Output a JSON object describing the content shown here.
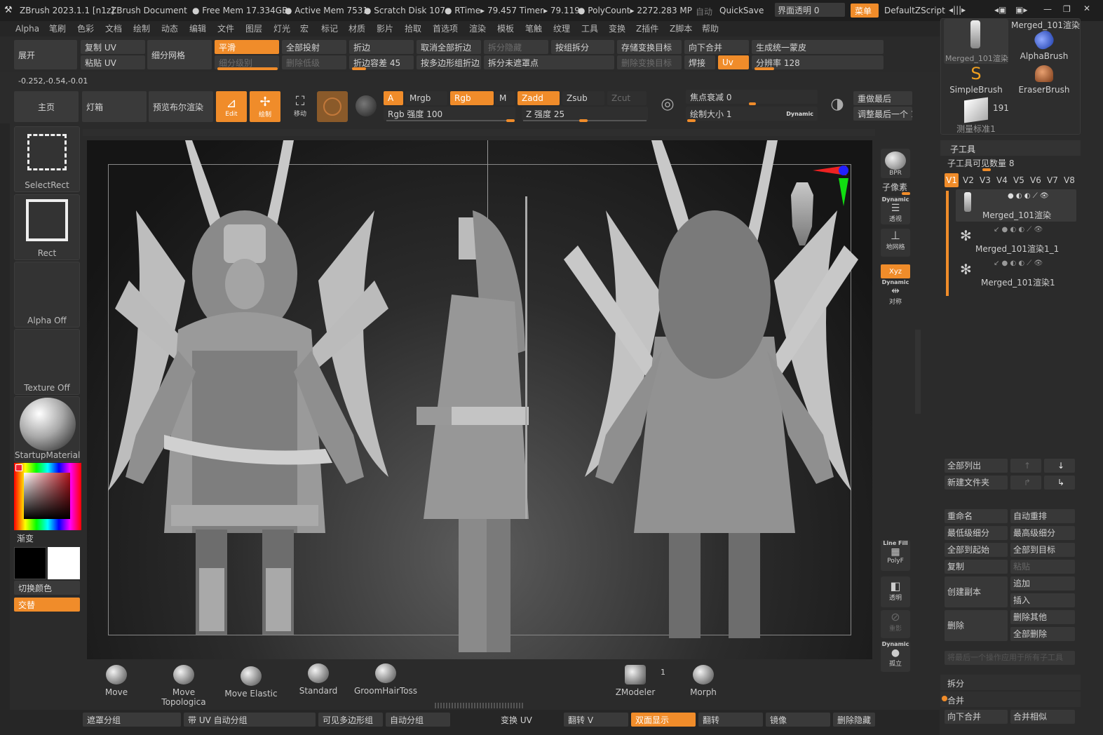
{
  "titlebar": {
    "app": "ZBrush 2023.1.1 [n1z]",
    "doc": "ZBrush Document",
    "free_mem": "Free Mem 17.334GB",
    "active_mem": "Active Mem 7531",
    "scratch": "Scratch Disk 107",
    "rtime": "RTime▸ 79.457 Timer▸ 79.119",
    "polycount": "PolyCount▸ 2272.283 MP",
    "auto": "自动",
    "quicksave": "QuickSave",
    "transparency": "界面透明 0",
    "menu": "菜单",
    "zscript": "DefaultZScript"
  },
  "menu": [
    "Alpha",
    "笔刷",
    "色彩",
    "文档",
    "绘制",
    "动态",
    "编辑",
    "文件",
    "图层",
    "灯光",
    "宏",
    "标记",
    "材质",
    "影片",
    "拾取",
    "首选项",
    "渲染",
    "模板",
    "笔触",
    "纹理",
    "工具",
    "变换",
    "Z插件",
    "Z脚本",
    "帮助"
  ],
  "toolbar1": {
    "unwrap": "展开",
    "copy_uv": "复制 UV",
    "paste_uv": "粘贴 UV",
    "subdivide": "细分网格",
    "smooth": "平滑",
    "subdiv_level": "细分级别",
    "project_all": "全部投射",
    "del_lower": "删除低级",
    "crease": "折边",
    "crease_tol": "折边容差 45",
    "uncrease_all": "取消全部折边",
    "crease_pg": "按多边形组折边",
    "split_hidden": "拆分隐藏",
    "split_unmasked": "拆分未遮罩点",
    "groups_split": "按组拆分",
    "store_morph": "存储变换目标",
    "del_morph": "删除变换目标",
    "merge_down": "向下合并",
    "weld": "焊接",
    "uv": "Uv",
    "unified_skin": "生成统一蒙皮",
    "resolution": "分辨率 128"
  },
  "coords": "-0.252,-0.54,-0.01",
  "toolbar2": {
    "home": "主页",
    "lightbox": "灯箱",
    "preview_bool": "预览布尔渲染",
    "edit": "Edit",
    "draw": "绘制",
    "move": "移动",
    "a": "A",
    "mrgb": "Mrgb",
    "rgb": "Rgb",
    "m": "M",
    "rgb_intensity": "Rgb 强度 100",
    "zadd": "Zadd",
    "zsub": "Zsub",
    "zcut": "Zcut",
    "z_intensity": "Z 强度 25",
    "focal": "焦点衰减 0",
    "draw_size": "绘制大小 1",
    "dynamic": "Dynamic",
    "redo": "重做最后",
    "adjust_last": "调整最后一个 1"
  },
  "left_tiles": {
    "select_rect": "SelectRect",
    "rect": "Rect",
    "alpha_off": "Alpha Off",
    "texture_off": "Texture Off",
    "material": "StartupMaterial",
    "gradient": "渐变",
    "switch_color": "切换颜色",
    "alternate": "交替"
  },
  "canvas_side": {
    "bpr": "BPR",
    "subpixel": "子像素",
    "dynamic": "Dynamic",
    "persp": "透视",
    "floor": "地网格",
    "xyz": "Xyz",
    "dynamic2": "Dynamic",
    "sym": "对称",
    "linefill": "Line Fill",
    "polyf": "PolyF",
    "transp": "透明",
    "ghost": "重影",
    "dynamic3": "Dynamic",
    "solo": "孤立"
  },
  "brushes": [
    {
      "name": "Move"
    },
    {
      "name": "Move Topologica"
    },
    {
      "name": "Move Elastic"
    },
    {
      "name": "Standard"
    },
    {
      "name": "GroomHairToss"
    },
    {
      "name": "ZModeler",
      "badge": "1"
    },
    {
      "name": "Morph"
    }
  ],
  "bottombar": {
    "mask_group": "遮罩分组",
    "uv_autogroup": "带 UV 自动分组",
    "polygroup_visible": "可见多边形组",
    "autogroup": "自动分组",
    "transform_uv": "变换 UV",
    "flip_v": "翻转 V",
    "double": "双面显示",
    "flip": "翻转",
    "mirror": "镜像",
    "del_hidden": "删除隐藏"
  },
  "tool_palette": {
    "merged_top": "Merged_101渲染",
    "merged_thumb": "Merged_101渲染",
    "alpha_brush": "AlphaBrush",
    "simple_brush": "SimpleBrush",
    "eraser_brush": "EraserBrush",
    "count": "191",
    "test": "测量标准1"
  },
  "subtool": {
    "title": "子工具",
    "visible_count": "子工具可见数量 8",
    "versions": [
      "V1",
      "V2",
      "V3",
      "V4",
      "V5",
      "V6",
      "V7",
      "V8"
    ],
    "items": [
      {
        "name": "Merged_101渲染"
      },
      {
        "name": "Merged_101渲染1_1"
      },
      {
        "name": "Merged_101渲染1"
      }
    ],
    "list_all": "全部列出",
    "new_folder": "新建文件夹",
    "rename": "重命名",
    "auto_reorder": "自动重排",
    "lowest_sub": "最低级细分",
    "highest_sub": "最高级细分",
    "all_to_start": "全部到起始",
    "all_to_target": "全部到目标",
    "copy": "复制",
    "paste": "粘贴",
    "duplicate": "创建副本",
    "append": "追加",
    "insert": "插入",
    "delete": "删除",
    "del_other": "删除其他",
    "del_all": "全部删除",
    "apply_all": "将最后一个操作应用于所有子工具",
    "split": "拆分",
    "merge": "合并",
    "merge_down": "向下合并",
    "merge_similar": "合并相似"
  },
  "colors": {
    "accent": "#f08c2a",
    "bg": "#2b2b2b"
  }
}
